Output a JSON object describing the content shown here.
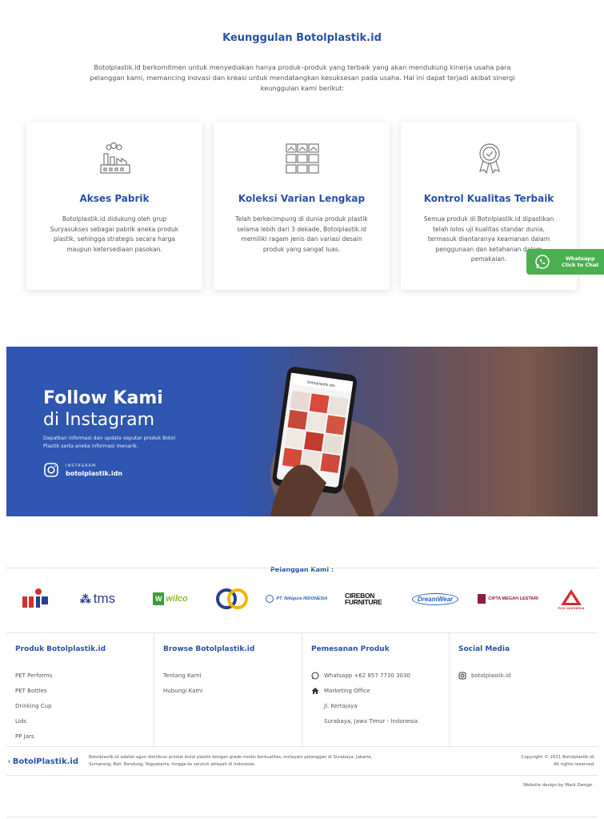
{
  "advantages": {
    "title": "Keunggulan Botolplastik.id",
    "description": "Botolplastik.id berkomitmen untuk menyediakan hanya produk–produk yang terbaik yang akan mendukung kinerja usaha para pelanggan kami, memancing inovasi dan kreasi untuk mendatangkan kesuksesan pada usaha. Hal ini dapat terjadi akibat sinergi keunggulan kami berikut:",
    "cards": [
      {
        "icon": "factory-icon",
        "title": "Akses Pabrik",
        "text": "Botolplastik.id didukung oleh grup Suryasukses sebagai pabrik aneka produk plastik, sehingga strategis secara harga maupun ketersediaan pasokan."
      },
      {
        "icon": "gallery-icon",
        "title": "Koleksi Varian Lengkap",
        "text": "Telah berkecimpung di dunia produk plastik selama lebih dari 3 dekade, Botolplastik.id memiliki ragam jenis dan variasi desain produk yang sangat luas."
      },
      {
        "icon": "quality-badge-icon",
        "title": "Kontrol Kualitas Terbaik",
        "text": "Semua produk di Botolplastik.id dipastikan telah lolos uji kualitas standar dunia, termasuk diantaranya keamanan dalam penggunaan dan ketahanan dalam pemakaian."
      }
    ]
  },
  "whatsapp_float": {
    "line1": "Whatsapp",
    "line2": "Click to Chat"
  },
  "instagram_banner": {
    "title_line1": "Follow Kami",
    "title_line2": "di Instagram",
    "description": "Dapatkan informasi dan update seputar produk Botol Plastik serta aneka informasi menarik.",
    "label": "INSTAGRAM",
    "handle": "botolplastik.idn",
    "phone_app_handle": "botolplastik.idn"
  },
  "customers": {
    "label": "Pelanggan Kami :",
    "logos": [
      "mp",
      "tms",
      "wilco",
      "OO",
      "PT. Niitigura INDONESIA",
      "CIREBON FURNITURE",
      "DreamWear",
      "CIPTA MEGAH LESTARI",
      "PICK INDONESIA"
    ]
  },
  "footer": {
    "columns": [
      {
        "title": "Produk Botolplastik.id",
        "items": [
          "PET Performs",
          "PET Bottles",
          "Drinking Cup",
          "Lids",
          "PP Jars"
        ]
      },
      {
        "title": "Browse Botolplastik.id",
        "items": [
          "Tentang Kami",
          "Hubungi Kami"
        ]
      },
      {
        "title": "Pemesanan Produk",
        "items": [
          "Whatsapp +62 857 7730 3030",
          "Marketing Office",
          "Jl. Kertajaya",
          "Surabaya, Jawa Timur - Indonesia"
        ]
      },
      {
        "title": "Social Media",
        "items": [
          "botolplastik.id"
        ]
      }
    ],
    "brand_prefix": "Botol",
    "brand_suffix": "Plastik.id",
    "brand_description": "Botolplastik.id adalah agen distribusi produk botol plastik dengan grade medis berkualitas, melayani pelanggan di Surabaya, Jakarta, Semarang, Bali, Bandung, Yogyakarta, hingga ke seluruh wilayah di Indonesia.",
    "copyright_line1": "Copyright © 2021 Botolplastik.id.",
    "copyright_line2": "All rights reserved.",
    "credit": "Website design by Mark Design ."
  },
  "colors": {
    "primary": "#2a52a8",
    "whatsapp": "#4caf50",
    "banner": "#2f56b0"
  }
}
